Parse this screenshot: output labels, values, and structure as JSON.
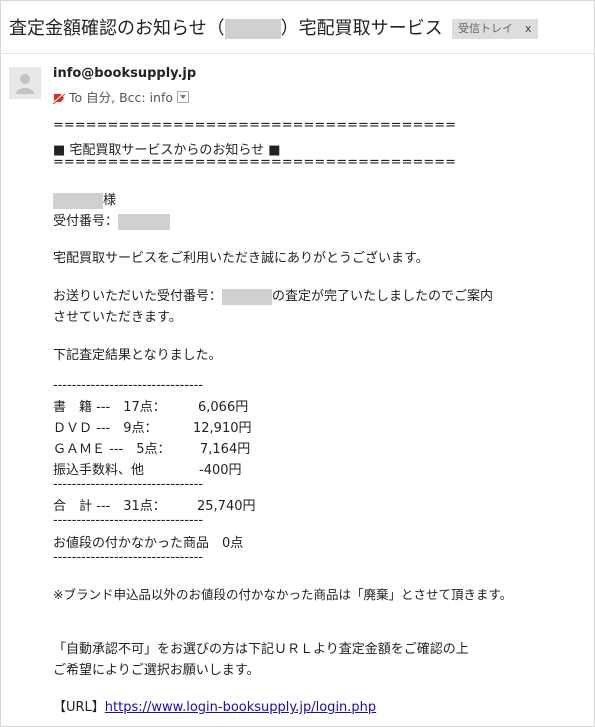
{
  "header": {
    "subject_prefix": "査定金額確認のお知らせ（",
    "subject_suffix": "）宅配買取サービス",
    "label": "受信トレイ",
    "label_close": "x"
  },
  "sender": {
    "email": "info@booksupply.jp",
    "recipients": "To 自分, Bcc: info"
  },
  "body": {
    "rule": "=====================================",
    "notice_title": "■ 宅配買取サービスからのお知らせ ■",
    "honorific": "様",
    "receipt_label": "受付番号：",
    "thanks": "宅配買取サービスをご利用いただき誠にありがとうございます。",
    "completed_prefix": "お送りいただいた受付番号：",
    "completed_suffix": "の査定が完了いたしましたのでご案内",
    "completed_line2": "させていただきます。",
    "result_intro": "下記査定結果となりました。",
    "dash_rule": "--------------------------------",
    "items": [
      {
        "label": "書　籍 ---　17点：",
        "amount": "6,066円"
      },
      {
        "label": "ＤＶＤ ---　9点：",
        "amount": "12,910円"
      },
      {
        "label": "ＧＡＭＥ ---　5点：",
        "amount": "7,164円"
      },
      {
        "label": "振込手数料、他",
        "amount": "-400円"
      }
    ],
    "total": {
      "label": "合　計 ---　31点：",
      "amount": "25,740円"
    },
    "no_value": "お値段の付かなかった商品　0点",
    "brand_note": "※ブランド申込品以外のお値段の付かなかった商品は「廃棄」とさせて頂きます。",
    "manual_line1": "「自動承認不可」をお選びの方は下記ＵＲＬより査定金額をご確認の上",
    "manual_line2": "ご希望によりご選択お願いします。",
    "url_label": "【URL】",
    "url": "https://www.login-booksupply.jp/login.php"
  }
}
